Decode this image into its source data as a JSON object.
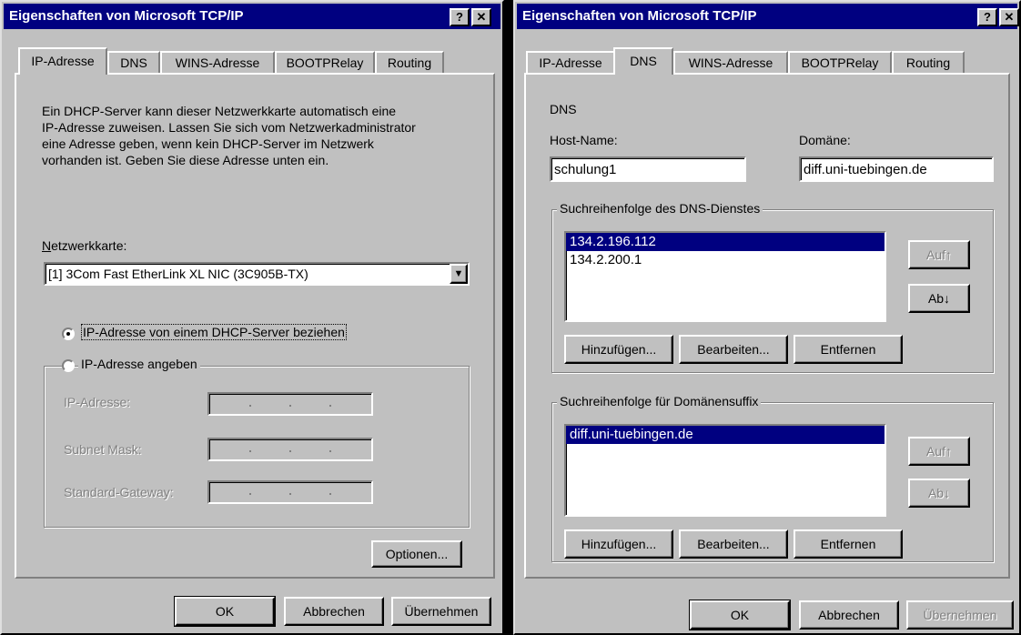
{
  "left_dialog": {
    "title": "Eigenschaften von Microsoft TCP/IP",
    "help_btn": "?",
    "close_btn": "✕",
    "tabs": [
      "IP-Adresse",
      "DNS",
      "WINS-Adresse",
      "BOOTPRelay",
      "Routing"
    ],
    "description": [
      "Ein DHCP-Server kann dieser Netzwerkkarte automatisch eine",
      "IP-Adresse zuweisen. Lassen Sie sich vom Netzwerkadministrator",
      "eine Adresse geben, wenn kein DHCP-Server im Netzwerk",
      "vorhanden ist. Geben Sie diese Adresse unten ein."
    ],
    "adapter_label_u": "N",
    "adapter_label_rest": "etzwerkkarte:",
    "adapter_value": "[1] 3Com Fast EtherLink XL NIC (3C905B-TX)",
    "dropdown_arrow": "▼",
    "radio_dhcp": "IP-Adresse von einem DHCP-Server beziehen",
    "radio_manual": "IP-Adresse angeben",
    "field_ip": "IP-Adresse:",
    "field_mask": "Subnet Mask:",
    "field_gateway": "Standard-Gateway:",
    "options_btn": "Optionen...",
    "ok_btn": "OK",
    "cancel_btn": "Abbrechen",
    "apply_btn": "Übernehmen"
  },
  "right_dialog": {
    "title": "Eigenschaften von Microsoft TCP/IP",
    "help_btn": "?",
    "close_btn": "✕",
    "tabs": [
      "IP-Adresse",
      "DNS",
      "WINS-Adresse",
      "BOOTPRelay",
      "Routing"
    ],
    "dns_heading": "DNS",
    "host_label": "Host-Name:",
    "host_value": "schulung1",
    "domain_label": "Domäne:",
    "domain_value": "diff.uni-tuebingen.de",
    "group1_label": "Suchreihenfolge des DNS-Dienstes",
    "dns_servers": [
      "134.2.196.112",
      "134.2.200.1"
    ],
    "up_btn": "Auf↑",
    "down_btn": "Ab↓",
    "add_btn": "Hinzufügen...",
    "edit_btn": "Bearbeiten...",
    "remove_btn": "Entfernen",
    "group2_label": "Suchreihenfolge für Domänensuffix",
    "suffixes": [
      "diff.uni-tuebingen.de"
    ],
    "up2_btn": "Auf↑",
    "down2_btn": "Ab↓",
    "add2_btn": "Hinzufügen...",
    "edit2_btn": "Bearbeiten...",
    "remove2_btn": "Entfernen",
    "ok_btn": "OK",
    "cancel_btn": "Abbrechen",
    "apply_btn": "Übernehmen"
  }
}
